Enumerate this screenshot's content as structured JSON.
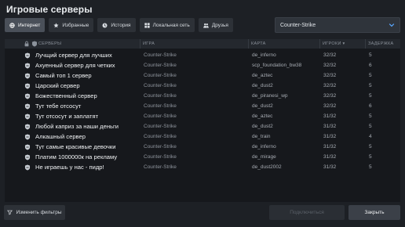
{
  "window": {
    "title": "Игровые серверы"
  },
  "tabs": [
    {
      "label": "Интернет",
      "icon": "globe-icon",
      "active": true
    },
    {
      "label": "Избранные",
      "icon": "star-icon",
      "active": false
    },
    {
      "label": "История",
      "icon": "history-icon",
      "active": false
    },
    {
      "label": "Локальная сеть",
      "icon": "lan-icon",
      "active": false
    },
    {
      "label": "Друзья",
      "icon": "friends-icon",
      "active": false
    }
  ],
  "game_filter": {
    "value": "Counter-Strike",
    "icon": "chevron-down-icon"
  },
  "columns": {
    "servers": "СЕРВЕРЫ",
    "game": "ИГРА",
    "map": "КАРТА",
    "players": "ИГРОКИ ▾",
    "latency": "ЗАДЕРЖКА"
  },
  "servers": [
    {
      "name": "Лучщий сервер для лучших",
      "game": "Counter-Strike",
      "map": "de_inferno",
      "players": "32/32",
      "ping": "5"
    },
    {
      "name": "Ахуенный сервер для четких",
      "game": "Counter-Strike",
      "map": "scp_foundation_bw38",
      "players": "32/32",
      "ping": "6"
    },
    {
      "name": "Самый топ 1 сервер",
      "game": "Counter-Strike",
      "map": "de_aztec",
      "players": "32/32",
      "ping": "5"
    },
    {
      "name": "Царский сервер",
      "game": "Counter-Strike",
      "map": "de_dust2",
      "players": "32/32",
      "ping": "5"
    },
    {
      "name": "Божественный сервер",
      "game": "Counter-Strike",
      "map": "de_piranesi_wp",
      "players": "32/32",
      "ping": "5"
    },
    {
      "name": "Тут тебе отсосут",
      "game": "Counter-Strike",
      "map": "de_dust2",
      "players": "32/32",
      "ping": "6"
    },
    {
      "name": "Тут отсосут и заплатят",
      "game": "Counter-Strike",
      "map": "de_aztec",
      "players": "31/32",
      "ping": "5"
    },
    {
      "name": "Любой каприз за наши деньги",
      "game": "Counter-Strike",
      "map": "de_dust2",
      "players": "31/32",
      "ping": "5"
    },
    {
      "name": "Алкашный сервер",
      "game": "Counter-Strike",
      "map": "de_train",
      "players": "31/32",
      "ping": "4"
    },
    {
      "name": "Тут самые красивые девочки",
      "game": "Counter-Strike",
      "map": "de_inferno",
      "players": "31/32",
      "ping": "5"
    },
    {
      "name": "Платим 1000000к на рекламу",
      "game": "Counter-Strike",
      "map": "de_mirage",
      "players": "31/32",
      "ping": "5"
    },
    {
      "name": "Не играешь у нас - пидр!",
      "game": "Counter-Strike",
      "map": "de_dust2002",
      "players": "31/32",
      "ping": "5"
    }
  ],
  "buttons": {
    "change_filters": "Изменить фильтры",
    "connect": "Подключиться",
    "close": "Закрыть"
  },
  "colors": {
    "background": "#1d2025",
    "list_background": "#16181c",
    "active_tab": "#4a5059"
  }
}
